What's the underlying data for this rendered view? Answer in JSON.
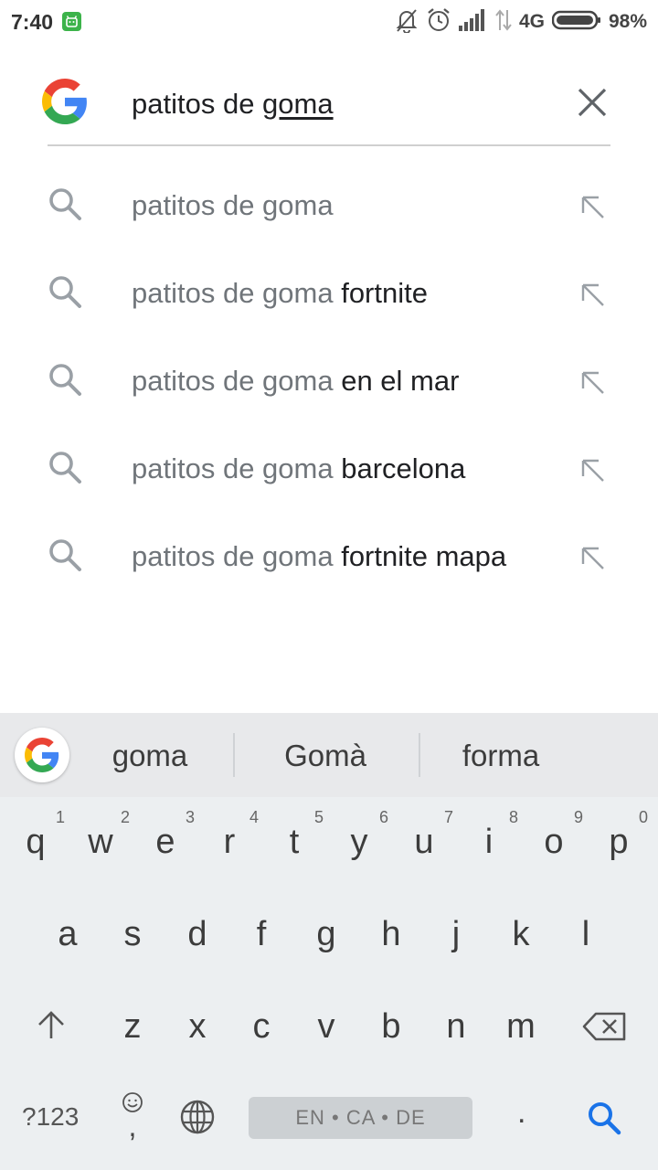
{
  "status_bar": {
    "time": "7:40",
    "network": "4G",
    "battery": "98%"
  },
  "search": {
    "prefix": "patitos de ",
    "composing": "goma"
  },
  "suggestions": [
    {
      "query": "patitos de goma",
      "rest": ""
    },
    {
      "query": "patitos de goma",
      "rest": " fortnite"
    },
    {
      "query": "patitos de goma",
      "rest": " en el mar"
    },
    {
      "query": "patitos de goma",
      "rest": " barcelona"
    },
    {
      "query": "patitos de goma",
      "rest": " fortnite mapa"
    }
  ],
  "keyboard": {
    "suggestions": [
      "goma",
      "Gomà",
      "forma"
    ],
    "row1": [
      "q",
      "w",
      "e",
      "r",
      "t",
      "y",
      "u",
      "i",
      "o",
      "p"
    ],
    "row1_nums": [
      "1",
      "2",
      "3",
      "4",
      "5",
      "6",
      "7",
      "8",
      "9",
      "0"
    ],
    "row2": [
      "a",
      "s",
      "d",
      "f",
      "g",
      "h",
      "j",
      "k",
      "l"
    ],
    "row3": [
      "z",
      "x",
      "c",
      "v",
      "b",
      "n",
      "m"
    ],
    "symbols_label": "?123",
    "emoji_comma": ",",
    "space_label": "EN • CA • DE",
    "period": "."
  },
  "colors": {
    "accent": "#1a73e8",
    "google_blue": "#4285F4",
    "google_red": "#EA4335",
    "google_yellow": "#FBBC05",
    "google_green": "#34A853"
  }
}
